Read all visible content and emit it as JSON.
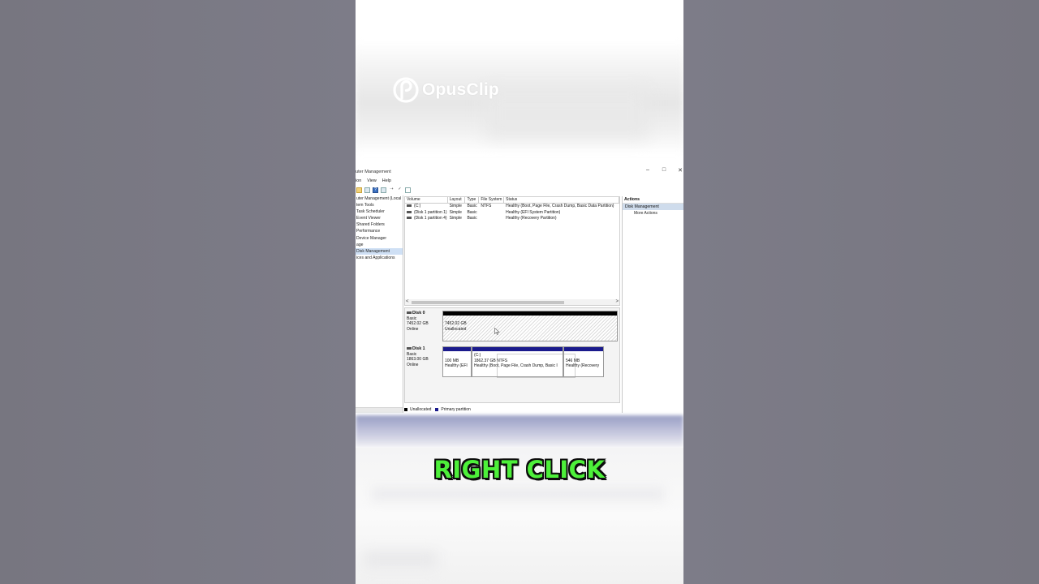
{
  "brand": {
    "logo_text": "OpusClip"
  },
  "window": {
    "title": "uter Management",
    "minimize": "–",
    "maximize": "□",
    "close": "✕",
    "menu": [
      "ion",
      "View",
      "Help"
    ]
  },
  "tree": {
    "items": [
      {
        "label": "uter Management (Local",
        "selected": false
      },
      {
        "label": "tem Tools",
        "selected": false
      },
      {
        "label": "Task Scheduler",
        "selected": false
      },
      {
        "label": "Event Viewer",
        "selected": false
      },
      {
        "label": "Shared Folders",
        "selected": false
      },
      {
        "label": "Performance",
        "selected": false
      },
      {
        "label": "Device Manager",
        "selected": false
      },
      {
        "label": "age",
        "selected": false
      },
      {
        "label": "Disk Management",
        "selected": true
      },
      {
        "label": "ices and Applications",
        "selected": false
      }
    ]
  },
  "volumes": {
    "headers": [
      "Volume",
      "Layout",
      "Type",
      "File System",
      "Status"
    ],
    "rows": [
      [
        "(C:)",
        "Simple",
        "Basic",
        "NTFS",
        "Healthy (Boot, Page File, Crash Dump, Basic Data Partition)"
      ],
      [
        "(Disk 1 partition 1)",
        "Simple",
        "Basic",
        "",
        "Healthy (EFI System Partition)"
      ],
      [
        "(Disk 1 partition 4)",
        "Simple",
        "Basic",
        "",
        "Healthy (Recovery Partition)"
      ]
    ],
    "scroll_left": "<",
    "scroll_right": ">"
  },
  "disks": [
    {
      "name": "Disk 0",
      "type": "Basic",
      "size": "7452.02 GB",
      "state": "Online",
      "partitions": [
        {
          "line1": "",
          "line2": "7452.02 GB",
          "line3": "Unallocated",
          "kind": "unallocated"
        }
      ]
    },
    {
      "name": "Disk 1",
      "type": "Basic",
      "size": "1863.00 GB",
      "state": "Online",
      "partitions": [
        {
          "line1": "",
          "line2": "100 MB",
          "line3": "Healthy (EFI",
          "kind": "primary"
        },
        {
          "line1": "(C:)",
          "line2": "1862.37 GB NTFS",
          "line3": "Healthy (Boot, Page File, Crash Dump, Basic I",
          "kind": "primary"
        },
        {
          "line1": "",
          "line2": "546 MB",
          "line3": "Healthy (Recovery",
          "kind": "primary"
        }
      ]
    }
  ],
  "legend": [
    {
      "label": "Unallocated",
      "color": "#000000"
    },
    {
      "label": "Primary partition",
      "color": "#1a1a8c"
    }
  ],
  "actions": {
    "header": "Actions",
    "selected": "Disk Management",
    "more": "More Actions"
  },
  "caption": "RIGHT CLICK",
  "colors": {
    "caption_green": "#4df03a",
    "disk_bar_primary": "#1a1a8c",
    "disk_bar_unallocated": "#000000"
  }
}
